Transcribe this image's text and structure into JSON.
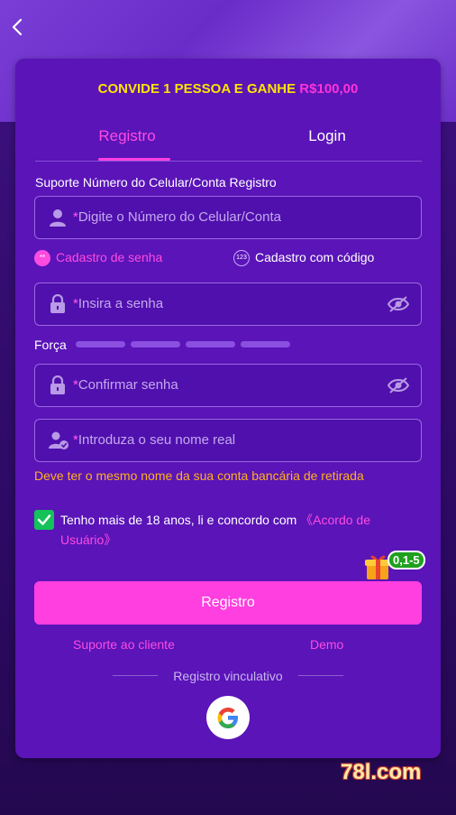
{
  "promo": {
    "prefix": "CONVIDE 1 PESSOA E GANHE",
    "amount": "R$100,00"
  },
  "tabs": [
    {
      "label": "Registro",
      "active": true
    },
    {
      "label": "Login",
      "active": false
    }
  ],
  "form": {
    "support_label": "Suporte Número do Celular/Conta Registro",
    "required_mark": "*",
    "phone_placeholder": "Digite o Número do Celular/Conta",
    "modes": [
      {
        "label": "Cadastro de senha",
        "selected": true,
        "badge": "**"
      },
      {
        "label": "Cadastro com código",
        "selected": false,
        "badge": "123"
      }
    ],
    "password_placeholder": "Insira a senha",
    "strength_label": "Força",
    "confirm_placeholder": "Confirmar senha",
    "realname_placeholder": "Introduza o seu nome real",
    "realname_warning": "Deve ter o mesmo nome da sua conta bancária de retirada",
    "agreement_text": "Tenho mais de 18 anos, li e concordo com",
    "agreement_link": "《Acordo de Usuário》",
    "agreement_checked": true
  },
  "gift_badge": "0,1-5",
  "submit_label": "Registro",
  "links": {
    "support": "Suporte ao cliente",
    "demo": "Demo"
  },
  "social": {
    "label": "Registro vinculativo"
  },
  "watermark": "78l.com",
  "colors": {
    "accent": "#ff3fe0",
    "promo_yellow": "#ffe400",
    "warning": "#ffb020",
    "check": "#14c25a",
    "card": "#5a14b8"
  }
}
